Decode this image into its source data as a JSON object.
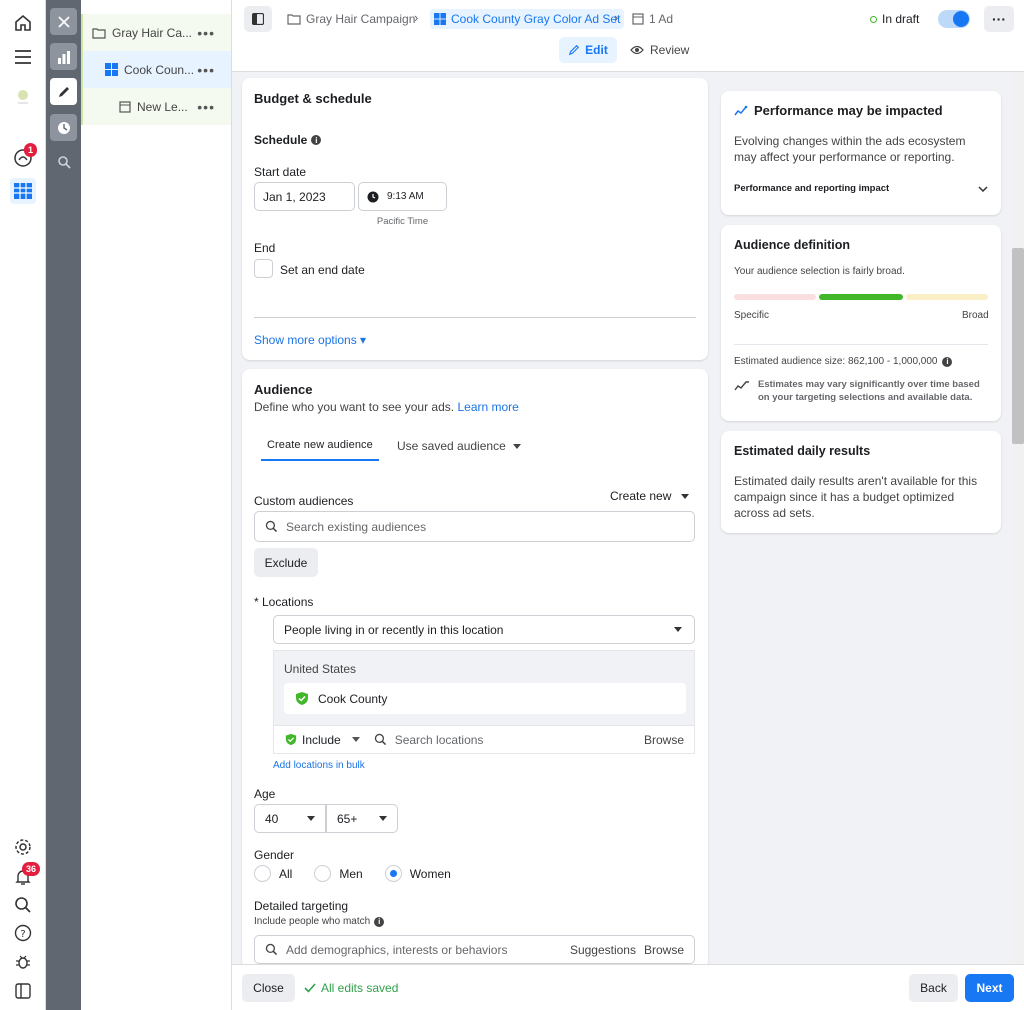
{
  "tree": {
    "campaign": "Gray Hair Ca...",
    "adset": "Cook Coun...",
    "ad": "New Le...",
    "more": "•••"
  },
  "header": {
    "crumbs": [
      "Gray Hair Campaign",
      "Cook County Gray Color Ad Set",
      "1 Ad"
    ],
    "status": "In draft",
    "more": "···",
    "tabs": {
      "edit": "Edit",
      "review": "Review"
    }
  },
  "budget": {
    "title": "Budget & schedule",
    "schedule_label": "Schedule",
    "start_label": "Start date",
    "start_date": "Jan 1, 2023",
    "start_time": "9:13 AM",
    "timezone": "Pacific Time",
    "end_label": "End",
    "end_checkbox": "Set an end date",
    "more_options": "Show more options ▾"
  },
  "audience": {
    "title": "Audience",
    "subtitle": "Define who you want to see your ads.",
    "learn_more": "Learn more",
    "tab_new": "Create new audience",
    "tab_saved": "Use saved audience",
    "custom_label": "Custom audiences",
    "create_new": "Create new",
    "custom_placeholder": "Search existing audiences",
    "exclude": "Exclude",
    "locations_label": "* Locations",
    "location_mode": "People living in or recently in this location",
    "country": "United States",
    "county": "Cook County",
    "include": "Include",
    "search_locations_placeholder": "Search locations",
    "browse": "Browse",
    "bulk": "Add locations in bulk",
    "age_label": "Age",
    "age_min": "40",
    "age_max": "65+",
    "gender_label": "Gender",
    "genders": [
      "All",
      "Men",
      "Women"
    ],
    "gender_selected": "Women",
    "detailed_label": "Detailed targeting",
    "detailed_sub": "Include people who match",
    "detailed_placeholder": "Add demographics, interests or behaviors",
    "suggestions": "Suggestions",
    "browse2": "Browse"
  },
  "side": {
    "perf_title": "Performance may be impacted",
    "perf_body": "Evolving changes within the ads ecosystem may affect your performance or reporting.",
    "perf_link": "Performance and reporting impact",
    "aud_title": "Audience definition",
    "aud_body": "Your audience selection is fairly broad.",
    "specific": "Specific",
    "broad": "Broad",
    "aud_size": "Estimated audience size: 862,100 - 1,000,000",
    "aud_note": "Estimates may vary significantly over time based on your targeting selections and available data.",
    "daily_title": "Estimated daily results",
    "daily_body": "Estimated daily results aren't available for this campaign since it has a budget optimized across ad sets."
  },
  "footer": {
    "close": "Close",
    "saved": "All edits saved",
    "back": "Back",
    "next": "Next"
  },
  "badges": {
    "notifications": "1",
    "alerts": "36"
  },
  "colors": {
    "accent": "#1877f2",
    "green": "#42b72a",
    "strip": "#606770"
  }
}
